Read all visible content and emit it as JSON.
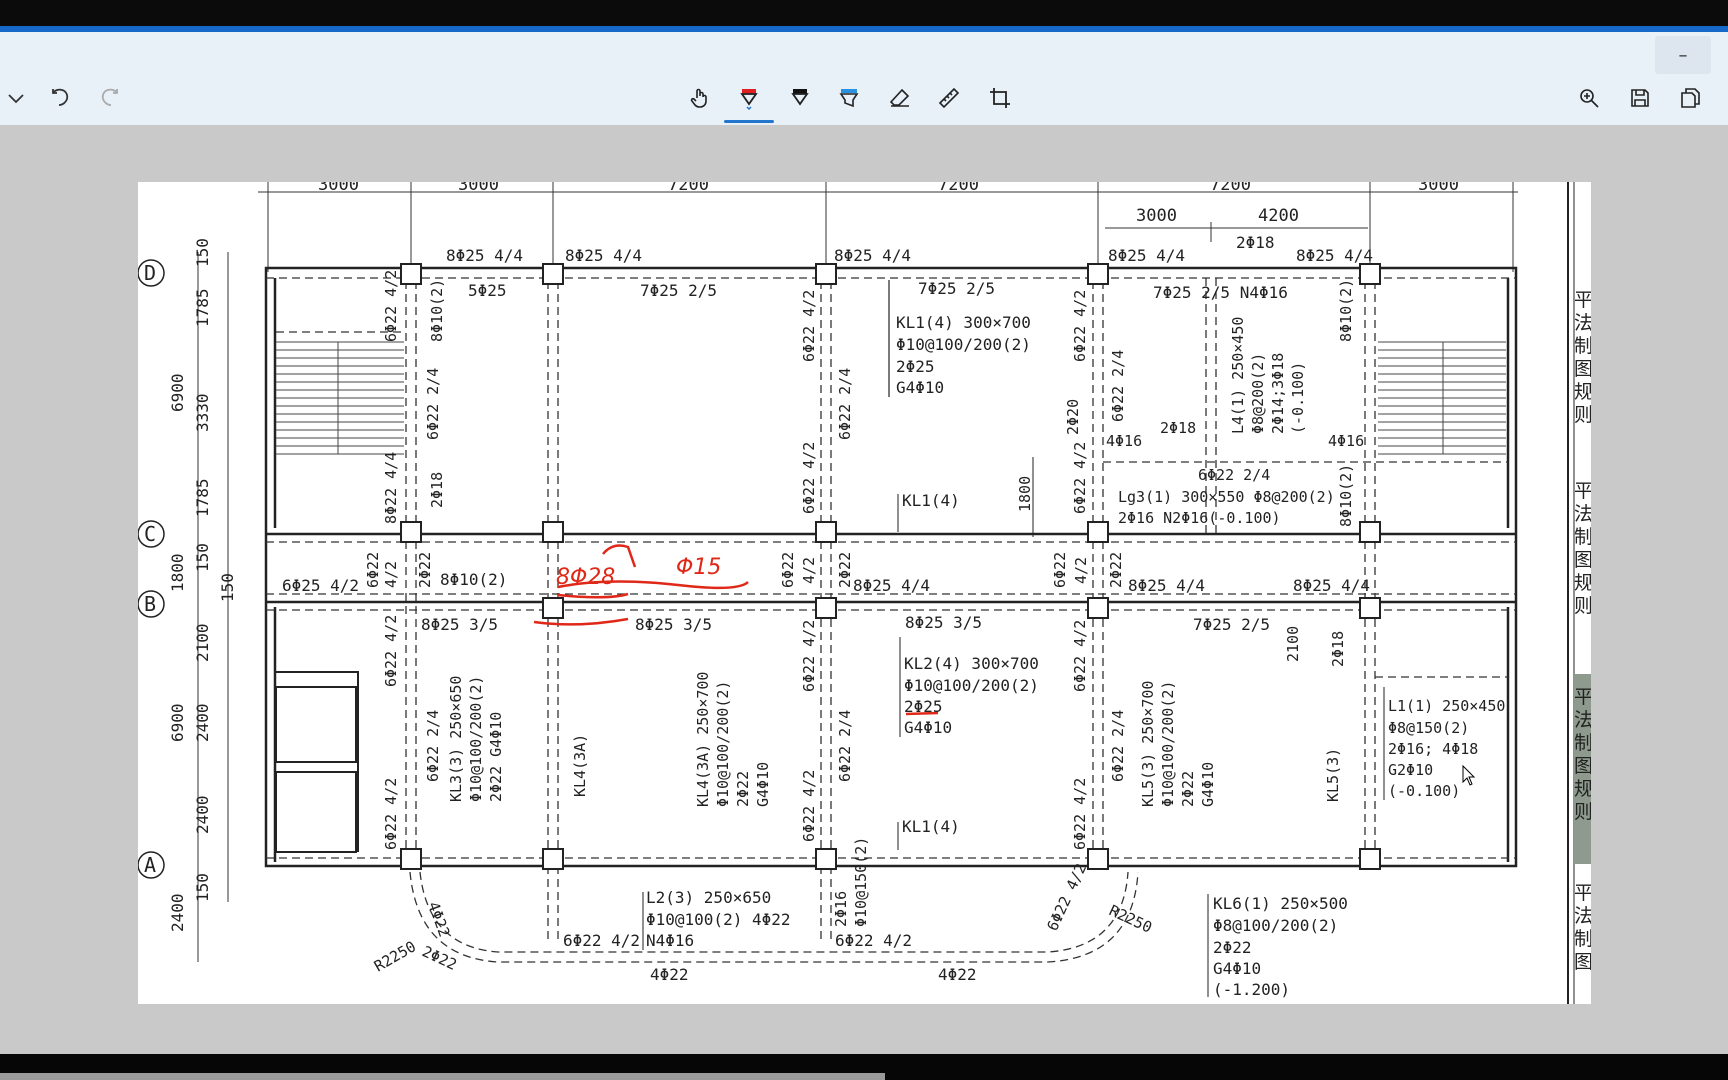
{
  "toolbar": {
    "tools": [
      {
        "name": "touch-write-tool",
        "icon": "touch-hand-icon"
      },
      {
        "name": "pen-tool",
        "icon": "pen-icon",
        "active": true
      },
      {
        "name": "pencil-tool",
        "icon": "pencil-icon"
      },
      {
        "name": "highlighter-tool",
        "icon": "highlighter-icon"
      },
      {
        "name": "eraser-tool",
        "icon": "eraser-icon"
      },
      {
        "name": "ruler-tool",
        "icon": "ruler-icon"
      },
      {
        "name": "crop-tool",
        "icon": "crop-icon"
      }
    ],
    "right": [
      "zoom-in-icon",
      "save-icon",
      "copy-icon"
    ],
    "min_symbol": "–",
    "accent": "#2277cc"
  },
  "drawing": {
    "top_dims": [
      "3000",
      "3000",
      "7200",
      "7200",
      "7200",
      "3000"
    ],
    "sub_dims": [
      "3000",
      "4200"
    ],
    "axes_rows": [
      "D",
      "C",
      "B",
      "A"
    ],
    "left_dims_outer": [
      "6900",
      "1800",
      "6900",
      "2400"
    ],
    "left_dims_inner": [
      "150",
      "1785",
      "3330",
      "1785",
      "150",
      "150",
      "2100",
      "2400",
      "2400",
      "150"
    ],
    "labels": {
      "d_top_1": "8Φ25 4/4",
      "d_top_2": "8Φ25 4/4",
      "d_top_3": "8Φ25 4/4",
      "d_top_4": "8Φ25 4/4",
      "d_top_5": "8Φ25 4/4",
      "d_mid_1": "5Φ25",
      "d_mid_2": "7Φ25 2/5",
      "d_mid_3": "7Φ25 2/5",
      "d_mid_4": "7Φ25 2/5 N4Φ16",
      "kl1_a": "KL1(4)  300×700",
      "kl1_b": "Φ10@100/200(2)",
      "kl1_c": "2Φ25",
      "kl1_d": "G4Φ10",
      "kl1_mark": "KL1(4)",
      "kl1_mark2": "KL1(4)",
      "l4_a": "L4(1) 250×450",
      "l4_b": "Φ8@200(2)",
      "l4_c": "2Φ14;3Φ18",
      "l4_d": "(-0.100)",
      "v1": "6Φ22 4/2",
      "v2": "8Φ10(2)",
      "v3": "6Φ22 2/4",
      "v4": "8Φ22 4/4",
      "v5": "2Φ18",
      "v6": "6Φ22 4/2",
      "v7": "6Φ22 2/4",
      "v8": "6Φ22 4/2",
      "v9": "6Φ22 4/2",
      "v10": "6Φ22 2/4",
      "v11": "2Φ20",
      "v12": "8Φ10(2)",
      "v13": "4Φ16",
      "v14": "8Φ10(2)",
      "c_2phi18": "2Φ18",
      "c_6phi22": "6Φ22 2/4",
      "c_2phi18b": "2Φ18",
      "lg3_a": "Lg3(1)  300×550  Φ8@200(2)",
      "lg3_b": "2Φ16  N2Φ16(-0.100)",
      "dim_1800": "1800",
      "b_1": "6Φ25 4/2",
      "b_2": "8Φ10(2)",
      "b_3": "8Φ25 4/4",
      "b_4": "8Φ25 4/4",
      "b_5": "8Φ25 4/4",
      "b_6": "6Φ22",
      "b_7": "4/2",
      "b_8": "2Φ22",
      "b_9": "6Φ22",
      "b_10": "4/2",
      "b_11": "2Φ22",
      "b_bot_1": "8Φ25 3/5",
      "b_bot_2": "8Φ25 3/5",
      "b_bot_3": "8Φ25 3/5",
      "b_bot_4": "7Φ25 2/5",
      "kl2_a": "KL2(4)  300×700",
      "kl2_b": "Φ10@100/200(2)",
      "kl2_c": "2Φ25",
      "kl2_d": "G4Φ10",
      "kl3_a": "KL3(3) 250×650",
      "kl3_b": "Φ10@100/200(2)",
      "kl3_c": "2Φ22 G4Φ10",
      "kl4": "KL4(3A)",
      "kl4b_a": "KL4(3A) 250×700",
      "kl4b_b": "Φ10@100/200(2)",
      "kl4b_c": "2Φ22",
      "kl4b_d": "G4Φ10",
      "kl5_a": "KL5(3) 250×700",
      "kl5_b": "Φ10@100/200(2)",
      "kl5_c": "2Φ22",
      "kl5_d": "G4Φ10",
      "kl5": "KL5(3)",
      "l1_a": "L1(1)  250×450",
      "l1_b": "Φ8@150(2)",
      "l1_c": "2Φ16; 4Φ18",
      "l1_d": "G2Φ10",
      "l1_e": "(-0.100)",
      "dim_2100": "2100",
      "r_2phi18": "2Φ18",
      "l2_a": "L2(3)  250×650",
      "l2_b": "Φ10@100(2)  4Φ22",
      "l2_c": "N4Φ16",
      "bot_1": "6Φ22 4/2",
      "bot_2": "6Φ22 4/2",
      "bot_3": "4Φ22",
      "bot_4": "4Φ22",
      "bot_5": "2Φ16",
      "bot_6": "Φ10@150(2)",
      "bot_7": "4Φ22",
      "bot_8": "6Φ22 4/2",
      "r2250_l": "R2250",
      "r2250_r": "R2250",
      "r_2phi22": "2Φ22",
      "kl6_a": "KL6(1)  250×500",
      "kl6_b": "Φ8@100/200(2)",
      "kl6_c": "2Φ22",
      "kl6_d": "G4Φ10",
      "kl6_e": "(-1.200)",
      "ink_1": "8Φ28",
      "ink_2": "Φ15",
      "right_panel": [
        "平",
        "法",
        "制",
        "图",
        "规",
        "则",
        "平",
        "法",
        "制",
        "图",
        "规",
        "则",
        "平",
        "法",
        "制",
        "图",
        "规",
        "则",
        "平",
        "法",
        "制",
        "图"
      ]
    }
  }
}
